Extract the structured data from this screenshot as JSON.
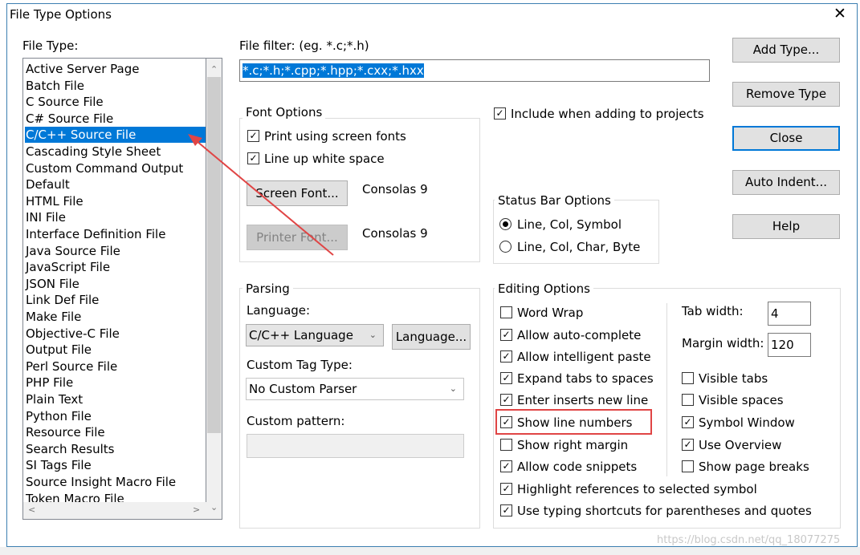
{
  "window": {
    "title": "File Type Options",
    "close_glyph": "✕"
  },
  "file_type": {
    "label": "File Type:",
    "items": [
      "Active Server Page",
      "Batch File",
      "C Source File",
      "C# Source File",
      "C/C++ Source File",
      "Cascading Style Sheet",
      "Custom Command Output",
      "Default",
      "HTML File",
      "INI File",
      "Interface Definition File",
      "Java Source File",
      "JavaScript File",
      "JSON File",
      "Link Def File",
      "Make File",
      "Objective-C File",
      "Output File",
      "Perl Source File",
      "PHP File",
      "Plain Text",
      "Python File",
      "Resource File",
      "Search Results",
      "SI Tags File",
      "Source Insight Macro File",
      "Token Macro File"
    ],
    "selected_index": 4,
    "scroll_up": "⌃",
    "scroll_down": "⌄",
    "scroll_left": "<",
    "scroll_right": ">"
  },
  "file_filter": {
    "label": "File filter: (eg. *.c;*.h)",
    "value": "*.c;*.h;*.cpp;*.hpp;*.cxx;*.hxx"
  },
  "font_options": {
    "title": "Font Options",
    "print_screen_fonts": {
      "label": "Print using screen fonts",
      "checked": true
    },
    "line_up_white_space": {
      "label": "Line up white space",
      "checked": true
    },
    "screen_font_button": "Screen Font...",
    "screen_font_value": "Consolas 9",
    "printer_font_button": "Printer Font...",
    "printer_font_value": "Consolas 9"
  },
  "include_projects": {
    "label": "Include when adding to projects",
    "checked": true
  },
  "status_bar": {
    "title": "Status Bar Options",
    "options": [
      "Line, Col, Symbol",
      "Line, Col, Char, Byte"
    ],
    "selected_index": 0
  },
  "parsing": {
    "title": "Parsing",
    "language_label": "Language:",
    "language_value": "C/C++ Language",
    "language_button": "Language...",
    "custom_tag_label": "Custom Tag Type:",
    "custom_tag_value": "No Custom Parser",
    "custom_pattern_label": "Custom pattern:",
    "custom_pattern_value": ""
  },
  "editing": {
    "title": "Editing Options",
    "left_options": [
      {
        "label": "Word Wrap",
        "checked": false
      },
      {
        "label": "Allow auto-complete",
        "checked": true
      },
      {
        "label": "Allow intelligent paste",
        "checked": true
      },
      {
        "label": "Expand tabs to spaces",
        "checked": true
      },
      {
        "label": "Enter inserts new line",
        "checked": true
      },
      {
        "label": "Show line numbers",
        "checked": true
      },
      {
        "label": "Show right margin",
        "checked": false
      },
      {
        "label": "Allow code snippets",
        "checked": true
      },
      {
        "label": "Highlight references to selected symbol",
        "checked": true
      },
      {
        "label": "Use typing shortcuts for parentheses and quotes",
        "checked": true
      }
    ],
    "tab_width_label": "Tab width:",
    "tab_width_value": "4",
    "margin_width_label": "Margin width:",
    "margin_width_value": "120",
    "right_options": [
      {
        "label": "Visible tabs",
        "checked": false
      },
      {
        "label": "Visible spaces",
        "checked": false
      },
      {
        "label": "Symbol Window",
        "checked": true
      },
      {
        "label": "Use Overview",
        "checked": true
      },
      {
        "label": "Show page breaks",
        "checked": false
      }
    ]
  },
  "buttons": {
    "add_type": "Add Type...",
    "remove_type": "Remove Type",
    "close": "Close",
    "auto_indent": "Auto Indent...",
    "help": "Help"
  },
  "annotation_color": "#e04545",
  "selection_color": "#0078d7",
  "watermark": "https://blog.csdn.net/qq_18077275"
}
